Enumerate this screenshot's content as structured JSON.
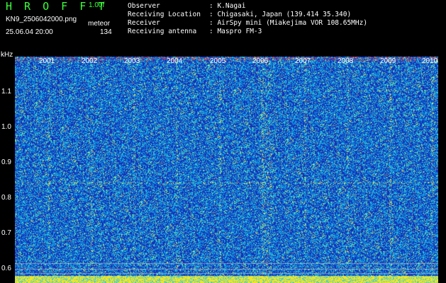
{
  "header": {
    "app_title": "H R O F F T",
    "version": "1.00f",
    "filename": "KN9_2506042000.png",
    "category": "meteor",
    "timestamp": "25.06.04 20:00",
    "count": "134",
    "fields": [
      {
        "label": "Observer",
        "value": ": K.Nagai"
      },
      {
        "label": "Receiving Location",
        "value": ": Chigasaki, Japan (139.414 35.340)"
      },
      {
        "label": "Receiver",
        "value": ": AirSpy mini (Miakejima VOR 108.65MHz)"
      },
      {
        "label": "Receiving antenna",
        "value": ": Maspro FM-3"
      }
    ]
  },
  "axis": {
    "y_unit": "kHz",
    "y_ticks": [
      "1.1",
      "1.0",
      "0.9",
      "0.8",
      "0.7",
      "0.6"
    ],
    "x_ticks": [
      "2001",
      "2002",
      "2003",
      "2004",
      "2005",
      "2006",
      "2007",
      "2008",
      "2009",
      "2010"
    ]
  },
  "colors": {
    "background": "#000000",
    "title_green": "#3cff3c",
    "plot_blue": "#1a2ec0"
  }
}
